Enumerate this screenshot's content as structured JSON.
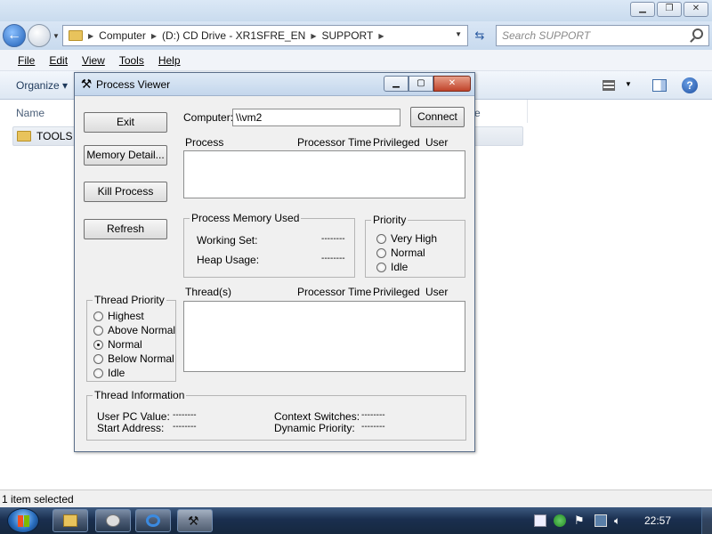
{
  "explorer": {
    "breadcrumbs": [
      "Computer",
      "(D:) CD Drive - XR1SFRE_EN",
      "SUPPORT"
    ],
    "search_placeholder": "Search SUPPORT",
    "menu": [
      "File",
      "Edit",
      "View",
      "Tools",
      "Help"
    ],
    "organize_label": "Organize",
    "column_name": "Name",
    "column_partial": "e",
    "folder_item": "TOOLS",
    "status_text": "1 item selected"
  },
  "taskbar": {
    "clock": "22:57"
  },
  "dialog": {
    "title": "Process Viewer",
    "buttons": {
      "exit": "Exit",
      "memory_detail": "Memory Detail...",
      "kill_process": "Kill Process",
      "refresh": "Refresh",
      "connect": "Connect"
    },
    "computer_label": "Computer:",
    "computer_value": "\\\\vm2",
    "process_headers": [
      "Process",
      "Processor Time",
      "Privileged",
      "User"
    ],
    "thread_headers": [
      "Thread(s)",
      "Processor Time",
      "Privileged",
      "User"
    ],
    "process_memory": {
      "title": "Process Memory Used",
      "working_set_label": "Working Set:",
      "working_set_value": "--------",
      "heap_usage_label": "Heap Usage:",
      "heap_usage_value": "--------"
    },
    "priority": {
      "title": "Priority",
      "options": [
        "Very High",
        "Normal",
        "Idle"
      ],
      "selected": null
    },
    "thread_priority": {
      "title": "Thread Priority",
      "options": [
        "Highest",
        "Above Normal",
        "Normal",
        "Below Normal",
        "Idle"
      ],
      "selected": "Normal"
    },
    "thread_info": {
      "title": "Thread Information",
      "user_pc_label": "User PC Value:",
      "user_pc_value": "--------",
      "start_address_label": "Start Address:",
      "start_address_value": "--------",
      "context_switches_label": "Context Switches:",
      "context_switches_value": "--------",
      "dynamic_priority_label": "Dynamic Priority:",
      "dynamic_priority_value": "--------"
    }
  }
}
